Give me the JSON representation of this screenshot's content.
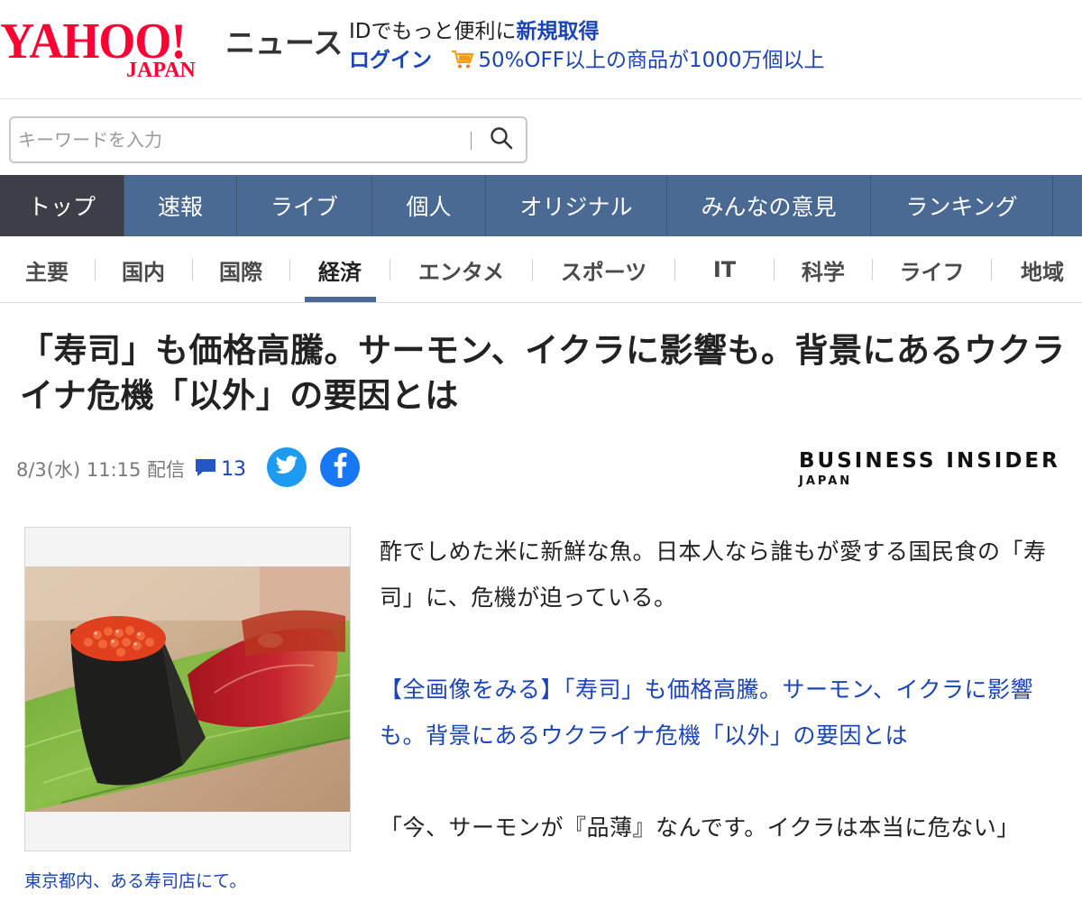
{
  "header": {
    "logo_text": "YAHOO!",
    "logo_subtext": "JAPAN",
    "section_label": "ニュース",
    "promo_line1_prefix": "IDでもっと便利に",
    "promo_line1_link": "新規取得",
    "login_label": "ログイン",
    "promo_line2": "50%OFF以上の商品が1000万個以上",
    "colors": {
      "brand_red": "#ff0033",
      "link_blue": "#1a44b8"
    }
  },
  "search": {
    "placeholder": "キーワードを入力",
    "value": "",
    "icon": "search-icon"
  },
  "main_nav": {
    "items": [
      {
        "label": "トップ",
        "active": true
      },
      {
        "label": "速報"
      },
      {
        "label": "ライブ"
      },
      {
        "label": "個人"
      },
      {
        "label": "オリジナル"
      },
      {
        "label": "みんなの意見"
      },
      {
        "label": "ランキング"
      }
    ],
    "colors": {
      "bar": "#4a6a93",
      "active": "#3c3f47"
    }
  },
  "sub_nav": {
    "items": [
      {
        "label": "主要"
      },
      {
        "label": "国内"
      },
      {
        "label": "国際"
      },
      {
        "label": "経済",
        "active": true
      },
      {
        "label": "エンタメ"
      },
      {
        "label": "スポーツ"
      },
      {
        "label": "IT"
      },
      {
        "label": "科学"
      },
      {
        "label": "ライフ"
      },
      {
        "label": "地域"
      }
    ]
  },
  "article": {
    "title": "「寿司」も価格高騰。サーモン、イクラに影響も。背景にあるウクライナ危機「以外」の要因とは",
    "date": "8/3(水) 11:15 配信",
    "comment_count": "13",
    "publisher_main": "BUSINESS INSIDER",
    "publisher_sub": "JAPAN",
    "image_caption": "東京都内、ある寿司店にて。",
    "paragraph1": "酢でしめた米に新鮮な魚。日本人なら誰もが愛する国民食の「寿司」に、危機が迫っている。",
    "paragraph2_link": "【全画像をみる】「寿司」も価格高騰。サーモン、イクラに影響も。背景にあるウクライナ危機「以外」の要因とは",
    "paragraph3": "「今、サーモンが『品薄』なんです。イクラは本当に危ない」"
  }
}
